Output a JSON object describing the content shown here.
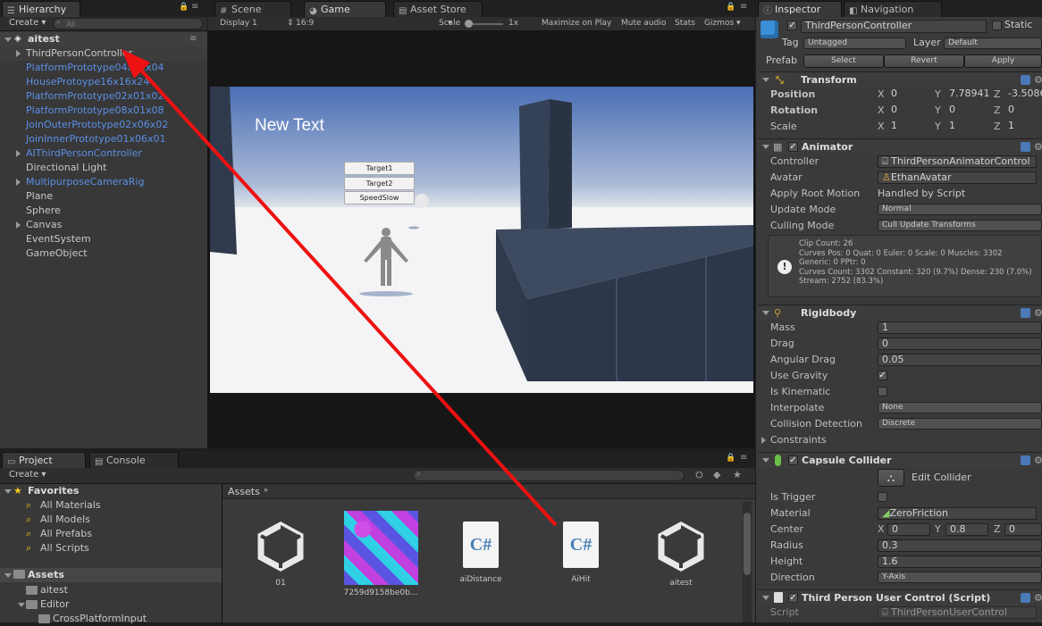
{
  "hierarchy": {
    "tab": "Hierarchy",
    "create": "Create",
    "search_placeholder": "All",
    "scene": "aitest",
    "items": [
      {
        "label": "ThirdPersonController",
        "color": "white",
        "expandable": true,
        "selected": true
      },
      {
        "label": "PlatformPrototype04x01x04",
        "color": "blue",
        "expandable": false
      },
      {
        "label": "HouseProtoype16x16x24",
        "color": "blue",
        "expandable": false
      },
      {
        "label": "PlatformPrototype02x01x02",
        "color": "blue",
        "expandable": false
      },
      {
        "label": "PlatformPrototype08x01x08",
        "color": "blue",
        "expandable": false
      },
      {
        "label": "JoinOuterPrototype02x06x02",
        "color": "blue",
        "expandable": false
      },
      {
        "label": "JoinInnerPrototype01x06x01",
        "color": "blue",
        "expandable": false
      },
      {
        "label": "AIThirdPersonController",
        "color": "blue",
        "expandable": true
      },
      {
        "label": "Directional Light",
        "color": "white",
        "expandable": false
      },
      {
        "label": "MultipurposeCameraRig",
        "color": "blue",
        "expandable": true
      },
      {
        "label": "Plane",
        "color": "white",
        "expandable": false
      },
      {
        "label": "Sphere",
        "color": "white",
        "expandable": false
      },
      {
        "label": "Canvas",
        "color": "white",
        "expandable": true
      },
      {
        "label": "EventSystem",
        "color": "white",
        "expandable": false
      },
      {
        "label": "GameObject",
        "color": "white",
        "expandable": false
      }
    ]
  },
  "center_tabs": {
    "scene": "Scene",
    "game": "Game",
    "asset_store": "Asset Store"
  },
  "game_toolbar": {
    "display": "Display 1",
    "aspect": "16:9",
    "scale_label": "Scale",
    "scale_value": "1x",
    "maximize": "Maximize on Play",
    "mute": "Mute audio",
    "stats": "Stats",
    "gizmos": "Gizmos"
  },
  "game_view": {
    "text": "New Text",
    "buttons": [
      "Target1",
      "Target2",
      "SpeedSlow"
    ]
  },
  "inspector": {
    "tab": "Inspector",
    "nav_tab": "Navigation",
    "object_name": "ThirdPersonController",
    "static_label": "Static",
    "tag_label": "Tag",
    "tag_value": "Untagged",
    "layer_label": "Layer",
    "layer_value": "Default",
    "prefab_label": "Prefab",
    "prefab_select": "Select",
    "prefab_revert": "Revert",
    "prefab_apply": "Apply",
    "transform": {
      "title": "Transform",
      "position_label": "Position",
      "position": [
        "0",
        "7.78941",
        "-3.5086"
      ],
      "rotation_label": "Rotation",
      "rotation": [
        "0",
        "0",
        "0"
      ],
      "scale_label": "Scale",
      "scale": [
        "1",
        "1",
        "1"
      ]
    },
    "animator": {
      "title": "Animator",
      "controller_label": "Controller",
      "controller": "ThirdPersonAnimatorControl",
      "avatar_label": "Avatar",
      "avatar": "EthanAvatar",
      "root_motion_label": "Apply Root Motion",
      "root_motion": "Handled by Script",
      "update_mode_label": "Update Mode",
      "update_mode": "Normal",
      "culling_mode_label": "Culling Mode",
      "culling_mode": "Cull Update Transforms",
      "info": [
        "Clip Count: 26",
        "Curves Pos: 0 Quat: 0 Euler: 0 Scale: 0 Muscles: 3302",
        "Generic: 0 PPtr: 0",
        "Curves Count: 3302 Constant: 320 (9.7%) Dense: 230 (7.0%)",
        "Stream: 2752 (83.3%)"
      ]
    },
    "rigidbody": {
      "title": "Rigidbody",
      "mass_label": "Mass",
      "mass": "1",
      "drag_label": "Drag",
      "drag": "0",
      "angular_drag_label": "Angular Drag",
      "angular_drag": "0.05",
      "use_gravity_label": "Use Gravity",
      "is_kinematic_label": "Is Kinematic",
      "interpolate_label": "Interpolate",
      "interpolate": "None",
      "collision_label": "Collision Detection",
      "collision": "Discrete",
      "constraints_label": "Constraints"
    },
    "capsule": {
      "title": "Capsule Collider",
      "edit_collider": "Edit Collider",
      "is_trigger_label": "Is Trigger",
      "material_label": "Material",
      "material": "ZeroFriction",
      "center_label": "Center",
      "center": [
        "0",
        "0.8",
        "0"
      ],
      "radius_label": "Radius",
      "radius": "0.3",
      "height_label": "Height",
      "height": "1.6",
      "direction_label": "Direction",
      "direction": "Y-Axis"
    },
    "script_comp": {
      "title": "Third Person User Control (Script)",
      "script_label": "Script",
      "script": "ThirdPersonUserControl"
    }
  },
  "project": {
    "tab": "Project",
    "console_tab": "Console",
    "create": "Create",
    "favorites": "Favorites",
    "fav_items": [
      "All Materials",
      "All Models",
      "All Prefabs",
      "All Scripts"
    ],
    "assets_label": "Assets",
    "folders": [
      "aitest",
      "Editor",
      "CrossPlatformInput"
    ],
    "breadcrumb": "Assets",
    "assets": [
      {
        "name": "01",
        "kind": "unity"
      },
      {
        "name": "7259d9158be0b...",
        "kind": "texture"
      },
      {
        "name": "aiDistance",
        "kind": "cs"
      },
      {
        "name": "AiHit",
        "kind": "cs"
      },
      {
        "name": "aitest",
        "kind": "unity"
      }
    ]
  }
}
